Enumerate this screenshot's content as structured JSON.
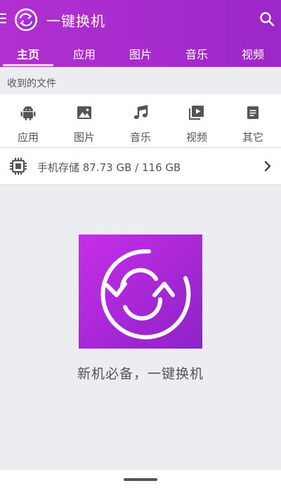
{
  "app": {
    "title": "一键换机"
  },
  "tabs": [
    {
      "label": "主页",
      "active": true
    },
    {
      "label": "应用"
    },
    {
      "label": "图片"
    },
    {
      "label": "音乐"
    },
    {
      "label": "视频"
    }
  ],
  "received_section": {
    "title": "收到的文件",
    "categories": [
      {
        "label": "应用",
        "icon": "android-icon"
      },
      {
        "label": "图片",
        "icon": "image-icon"
      },
      {
        "label": "音乐",
        "icon": "music-note-icon"
      },
      {
        "label": "视频",
        "icon": "video-icon"
      },
      {
        "label": "其它",
        "icon": "document-icon"
      }
    ]
  },
  "storage": {
    "text": "手机存储 87.73 GB / 116 GB"
  },
  "promo": {
    "slogan": "新机必备，一键换机"
  },
  "colors": {
    "brand_purple": "#a82ccd",
    "promo_gradient_start": "#c62ee8",
    "promo_gradient_end": "#8e22c8"
  }
}
